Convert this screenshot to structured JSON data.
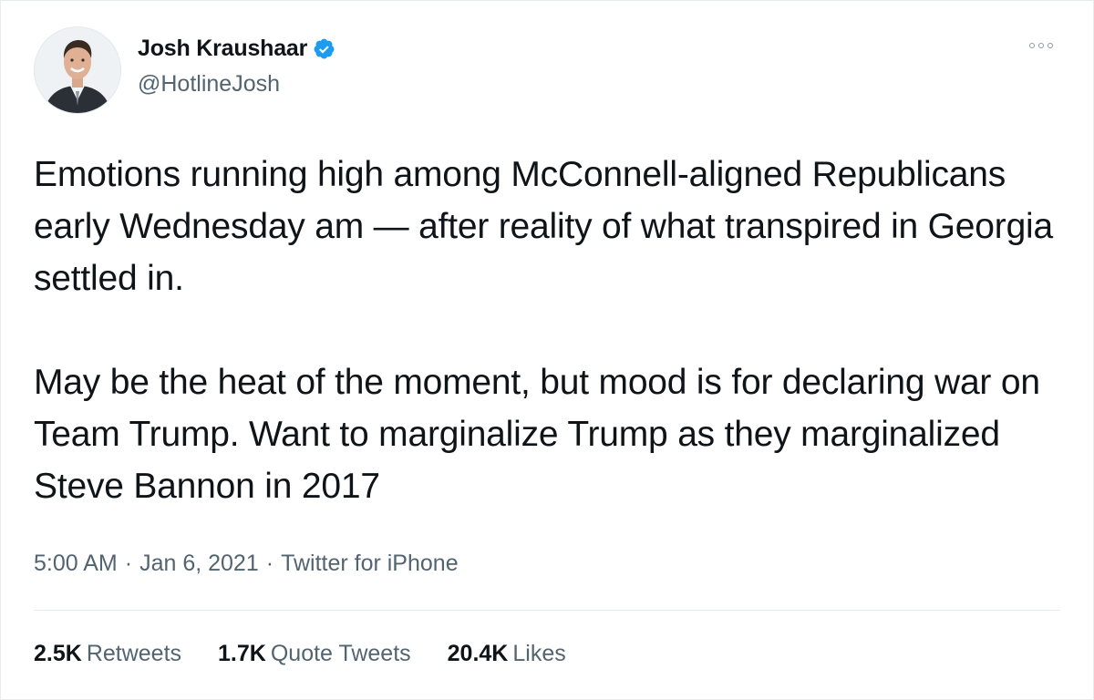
{
  "author": {
    "name": "Josh Kraushaar",
    "handle": "@HotlineJosh",
    "verified": true,
    "avatar_icon": "profile-photo"
  },
  "tweet": {
    "paragraphs": [
      "Emotions running high among McConnell-aligned Republicans early Wednesday am — after reality of what transpired in Georgia settled in.",
      "May be the heat of the moment, but mood is for declaring war on Team Trump. Want to marginalize Trump as they marginalized Steve Bannon in 2017"
    ],
    "time": "5:00 AM",
    "date": "Jan 6, 2021",
    "source": "Twitter for iPhone",
    "separator": "·"
  },
  "stats": {
    "retweets": {
      "count": "2.5K",
      "label": "Retweets"
    },
    "quotes": {
      "count": "1.7K",
      "label": "Quote Tweets"
    },
    "likes": {
      "count": "20.4K",
      "label": "Likes"
    }
  },
  "colors": {
    "text": "#0f1419",
    "secondary": "#536471",
    "verified": "#1d9bf0",
    "border": "#e6ecf0"
  },
  "icons": {
    "verified": "verified-badge-icon",
    "more": "more-options-icon"
  }
}
